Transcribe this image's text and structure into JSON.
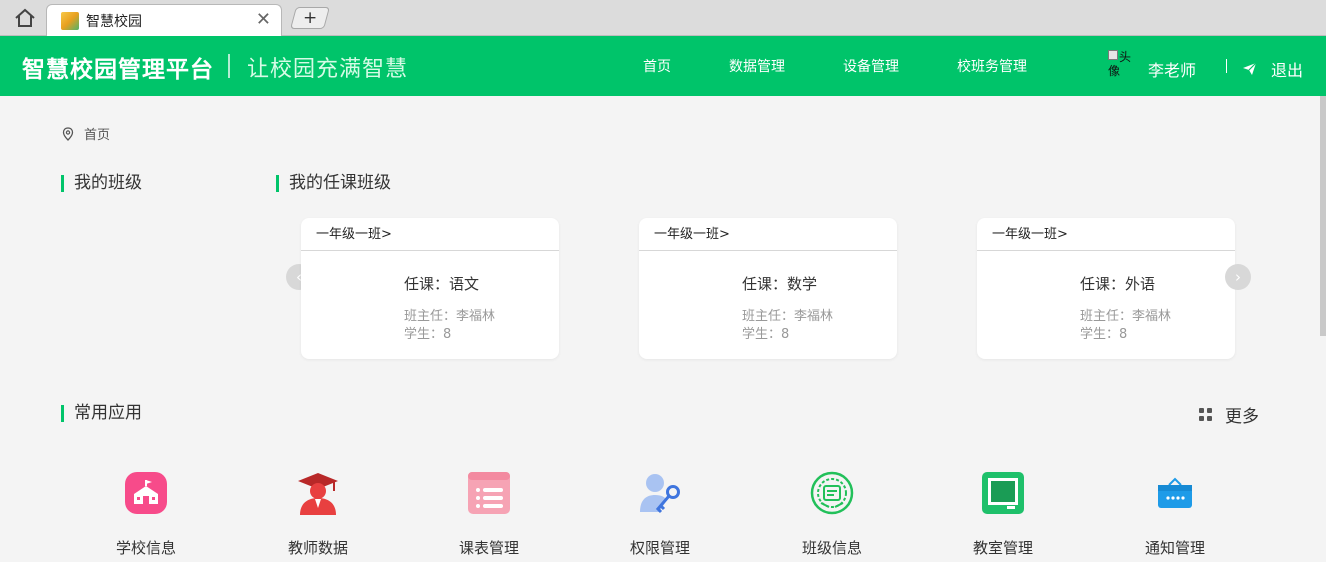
{
  "browser": {
    "tab_title": "智慧校园",
    "close_glyph": "✕",
    "new_tab_glyph": "+"
  },
  "header": {
    "brand": "智慧校园管理平台",
    "slogan": "让校园充满智慧",
    "nav": [
      "首页",
      "数据管理",
      "设备管理",
      "校班务管理"
    ],
    "avatar_alt": "头像",
    "username": "李老师",
    "logout": "退出"
  },
  "breadcrumb": {
    "current": "首页"
  },
  "sections": {
    "my_class": "我的班级",
    "teaching_classes": "我的任课班级",
    "common_apps": "常用应用",
    "more": "更多"
  },
  "cards": [
    {
      "class_name": "一年级一班>",
      "subject": "任课：语文",
      "head_teacher": "班主任：李福林",
      "students": "学生：8"
    },
    {
      "class_name": "一年级一班>",
      "subject": "任课：数学",
      "head_teacher": "班主任：李福林",
      "students": "学生：8"
    },
    {
      "class_name": "一年级一班>",
      "subject": "任课：外语",
      "head_teacher": "班主任：李福林",
      "students": "学生：8"
    }
  ],
  "carousel": {
    "prev_glyph": "‹",
    "next_glyph": "›"
  },
  "apps": [
    {
      "label": "学校信息",
      "icon": "school-icon",
      "color": "#f74b8a"
    },
    {
      "label": "教师数据",
      "icon": "teacher-icon",
      "color": "#e84040"
    },
    {
      "label": "课表管理",
      "icon": "schedule-list-icon",
      "color": "#f6a3b4"
    },
    {
      "label": "权限管理",
      "icon": "user-key-icon",
      "color": "#5b8be8"
    },
    {
      "label": "班级信息",
      "icon": "class-badge-icon",
      "color": "#22c05a"
    },
    {
      "label": "教室管理",
      "icon": "classroom-board-icon",
      "color": "#1ec06a"
    },
    {
      "label": "通知管理",
      "icon": "notice-box-icon",
      "color": "#1e9be8"
    }
  ],
  "colors": {
    "brand_green": "#00c46a",
    "background": "#f4f4f4"
  }
}
